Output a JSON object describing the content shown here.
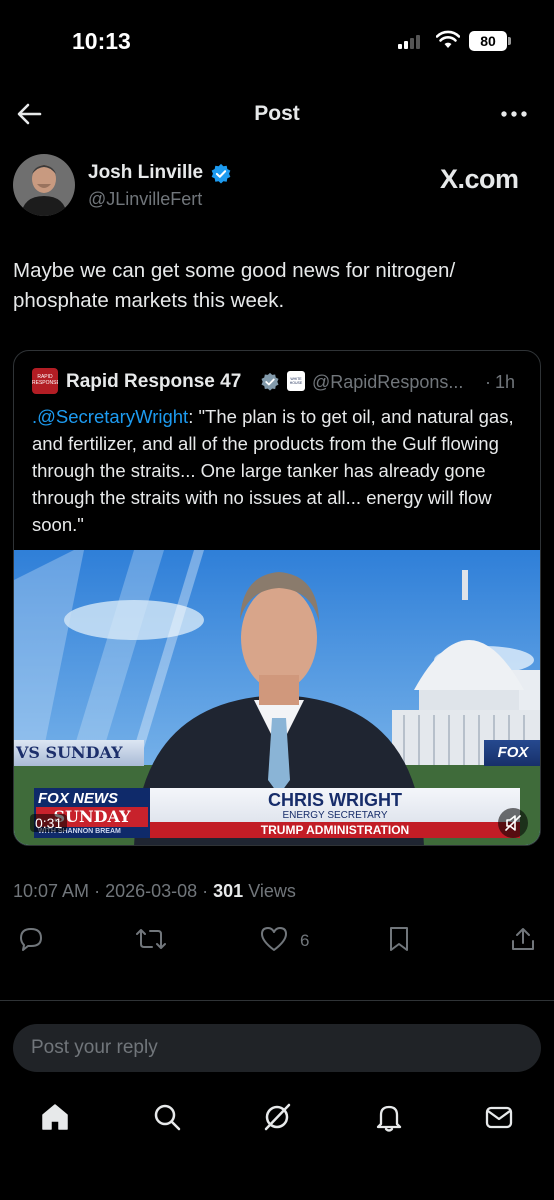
{
  "status_bar": {
    "time": "10:13",
    "battery": "80"
  },
  "header": {
    "title": "Post"
  },
  "author": {
    "name": "Josh Linville",
    "handle": "@JLinvilleFert",
    "source": "X.com"
  },
  "tweet": {
    "text": "Maybe we can get some good news for nitrogen/ phosphate markets this week."
  },
  "quote": {
    "logo_text": "RAPID RESPONSE",
    "name": "Rapid Response 47",
    "badge_text": "WHITE HOUSE",
    "handle": "@RapidRespons...",
    "separator": "·",
    "time": "1h",
    "mention": ".@SecretaryWright",
    "text": ": \"The plan is to get oil, and natural gas, and fertilizer, and all of the products from the Gulf flowing through the straits... One large tanker has already gone through the straits with no issues at all... energy will flow soon.\"",
    "video": {
      "duration": "0:31",
      "ticker_left": "VS SUNDAY",
      "ticker_right": "FOX",
      "logo_top": "FOX NEWS",
      "logo_main": "SUNDAY",
      "logo_sub": "WITH SHANNON BREAM",
      "chyron_name": "CHRIS WRIGHT",
      "chyron_role": "ENERGY SECRETARY",
      "chyron_admin": "TRUMP ADMINISTRATION"
    }
  },
  "meta": {
    "time": "10:07 AM",
    "date": "2026-03-08",
    "views_count": "301",
    "views_label": "Views"
  },
  "actions": {
    "likes": "6"
  },
  "reply": {
    "placeholder": "Post your reply"
  },
  "colors": {
    "accent": "#1d9bf0",
    "background": "#000000",
    "muted": "#71767b"
  },
  "icons": [
    "back-arrow-icon",
    "more-icon",
    "verified-icon",
    "reply-icon",
    "repost-icon",
    "like-icon",
    "bookmark-icon",
    "share-icon",
    "home-icon",
    "search-icon",
    "grok-icon",
    "notifications-icon",
    "messages-icon",
    "mute-icon"
  ]
}
